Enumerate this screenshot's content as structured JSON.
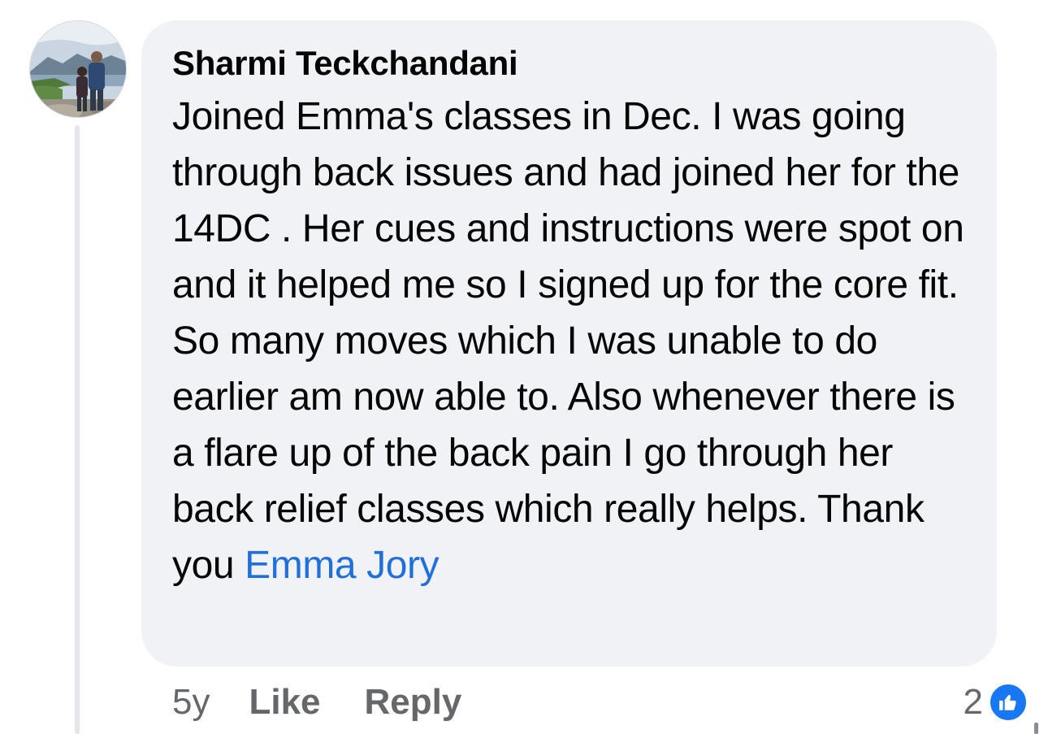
{
  "comment": {
    "author": "Sharmi Teckchandani",
    "text_before_mention": "Joined Emma's classes in Dec. I was going through back issues and had joined her for the 14DC . Her cues and instructions were spot on and it helped me so I signed up for the core fit. So many moves which I was unable to do earlier am now able to. Also whenever there is a flare up of the back pain I go through her back relief classes which really helps. Thank you ",
    "mention": "Emma Jory",
    "mention_color": "#216fdb"
  },
  "actions": {
    "timestamp": "5y",
    "like_label": "Like",
    "reply_label": "Reply"
  },
  "reactions": {
    "count": "2",
    "icon": "thumbs-up-icon",
    "badge_color": "#1877f2"
  },
  "colors": {
    "bubble": "#f0f2f5",
    "text": "#050505",
    "secondary": "#65676b"
  }
}
